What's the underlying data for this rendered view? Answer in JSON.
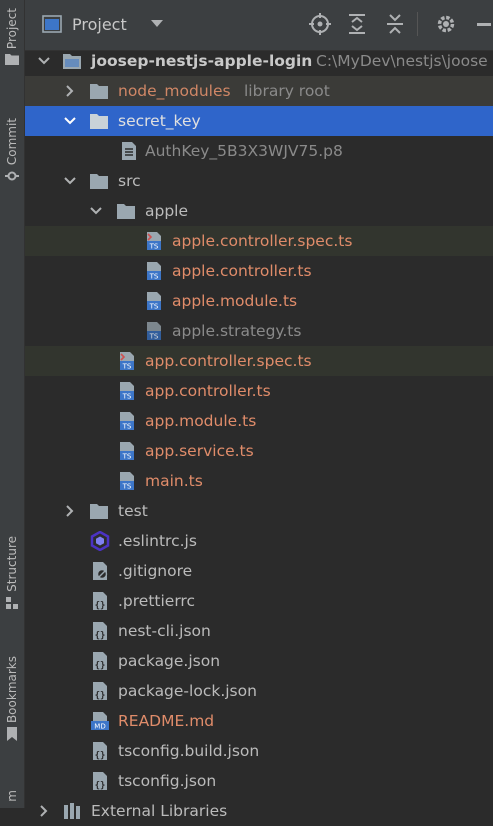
{
  "side_strip": {
    "project_label": "Project",
    "commit_label": "Commit",
    "structure_label": "Structure",
    "bookmarks_label": "Bookmarks",
    "bottom_label": "m"
  },
  "header": {
    "title": "Project"
  },
  "tree": {
    "root": {
      "name": "joosep-nestjs-apple-login",
      "path": "C:\\MyDev\\nestjs\\joose"
    },
    "node_modules": {
      "name": "node_modules",
      "hint": "library root"
    },
    "secret_key": {
      "name": "secret_key"
    },
    "authkey": {
      "name": "AuthKey_5B3X3WJV75.p8"
    },
    "src": {
      "name": "src"
    },
    "apple_dir": {
      "name": "apple"
    },
    "apple_files": [
      {
        "name": "apple.controller.spec.ts"
      },
      {
        "name": "apple.controller.ts"
      },
      {
        "name": "apple.module.ts"
      },
      {
        "name": "apple.strategy.ts"
      }
    ],
    "src_files": [
      {
        "name": "app.controller.spec.ts"
      },
      {
        "name": "app.controller.ts"
      },
      {
        "name": "app.module.ts"
      },
      {
        "name": "app.service.ts"
      },
      {
        "name": "main.ts"
      }
    ],
    "test": {
      "name": "test"
    },
    "root_files": [
      {
        "name": ".eslintrc.js"
      },
      {
        "name": ".gitignore"
      },
      {
        "name": ".prettierrc"
      },
      {
        "name": "nest-cli.json"
      },
      {
        "name": "package.json"
      },
      {
        "name": "package-lock.json"
      },
      {
        "name": "README.md"
      },
      {
        "name": "tsconfig.build.json"
      },
      {
        "name": "tsconfig.json"
      }
    ],
    "external": {
      "name": "External Libraries"
    }
  },
  "colors": {
    "selection": "#2f65ca",
    "modified_file": "#d08766",
    "folder": "#9aa7b0",
    "ts_badge": "#3d76c8"
  },
  "icons": {
    "folder": "folder-icon",
    "ts": "typescript-file-icon",
    "json": "json-file-icon",
    "markdown": "markdown-file-icon",
    "ignore": "gitignore-file-icon",
    "eslint": "eslint-icon"
  }
}
